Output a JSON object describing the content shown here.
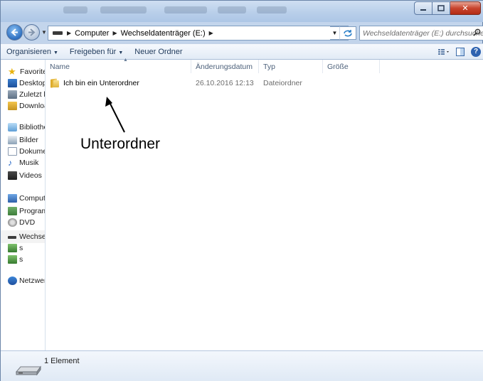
{
  "window": {
    "colors": {
      "title_bar": "#b9cfea",
      "close_button": "#c8452e",
      "content_bg": "#ffffff"
    },
    "buttons": {
      "minimize": "minimize-icon",
      "maximize": "maximize-icon",
      "close": "close-icon",
      "close_glyph": "✕"
    }
  },
  "address_bar": {
    "breadcrumbs": [
      "Computer",
      "Wechseldatenträger (E:)"
    ],
    "search_placeholder": "Wechseldatenträger (E:) durchsuchen"
  },
  "toolbar": {
    "organize": "Organisieren",
    "share": "Freigeben für",
    "new_folder": "Neuer Ordner"
  },
  "nav_pane": {
    "items": [
      {
        "label": "Favoriten",
        "icon": "star-icon"
      },
      {
        "label": "Desktop",
        "icon": "desktop-icon"
      },
      {
        "label": "Zuletzt besucht",
        "icon": "recent-places-icon"
      },
      {
        "label": "Downloads",
        "icon": "downloads-icon"
      },
      {
        "label": "Bibliotheken",
        "icon": "libraries-icon"
      },
      {
        "label": "Bilder",
        "icon": "pictures-icon"
      },
      {
        "label": "Dokumente",
        "icon": "documents-icon"
      },
      {
        "label": "Musik",
        "icon": "music-icon"
      },
      {
        "label": "Videos",
        "icon": "videos-icon"
      },
      {
        "label": "Computer",
        "icon": "computer-icon"
      },
      {
        "label": "Programme",
        "icon": "user-drive-icon"
      },
      {
        "label": "DVD",
        "icon": "dvd-drive-icon"
      },
      {
        "label": "Wechseldatenträger (E:)",
        "icon": "removable-drive-icon"
      },
      {
        "label": "s",
        "icon": "network-drive-icon"
      },
      {
        "label": "s",
        "icon": "network-drive-icon"
      },
      {
        "label": "Netzwerk",
        "icon": "network-icon"
      }
    ]
  },
  "file_list": {
    "columns": [
      "Name",
      "Änderungsdatum",
      "Typ",
      "Größe"
    ],
    "rows": [
      {
        "name": "Ich bin ein Unterordner",
        "date": "26.10.2016 12:13",
        "type": "Dateiordner",
        "size": ""
      }
    ]
  },
  "annotation": {
    "label": "Unterordner"
  },
  "status": {
    "count": "1 Element"
  }
}
